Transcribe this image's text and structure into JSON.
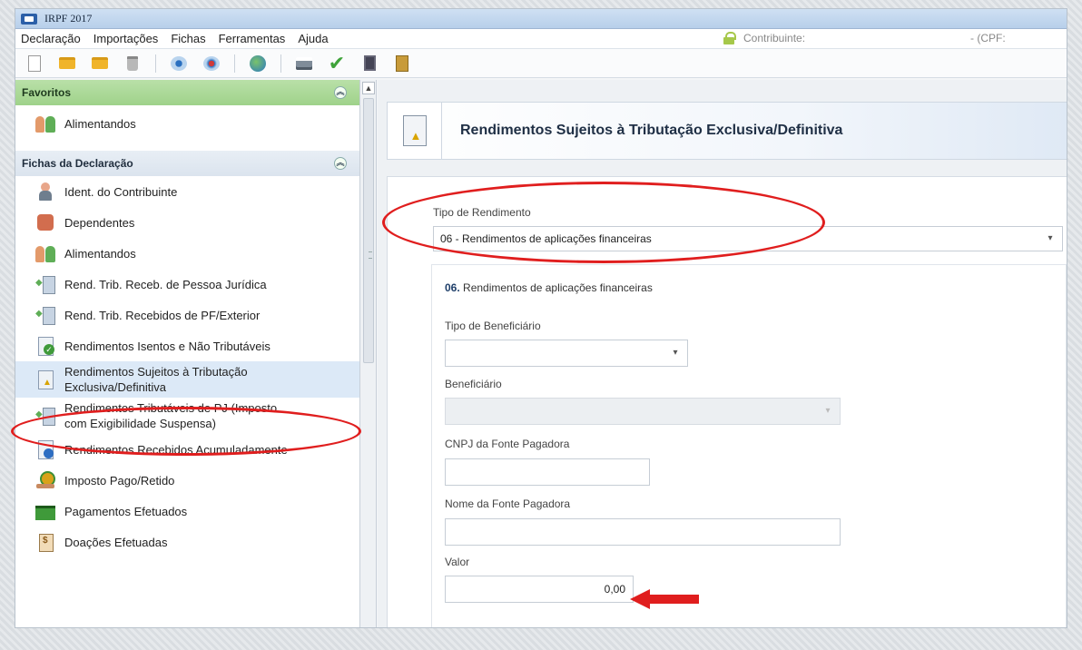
{
  "window": {
    "title": "IRPF 2017"
  },
  "menu": [
    "Declaração",
    "Importações",
    "Fichas",
    "Ferramentas",
    "Ajuda"
  ],
  "status": {
    "contribuinte_label": "Contribuinte:",
    "cpf_label": "- (CPF:"
  },
  "sidebar": {
    "favoritos_title": "Favoritos",
    "favoritos_items": [
      "Alimentandos"
    ],
    "fichas_title": "Fichas da Declaração",
    "items": [
      {
        "label": "Ident. do Contribuinte",
        "icon": "person-icon"
      },
      {
        "label": "Dependentes",
        "icon": "dependents-icon"
      },
      {
        "label": "Alimentandos",
        "icon": "people-icon"
      },
      {
        "label": "Rend. Trib. Receb. de Pessoa Jurídica",
        "icon": "income-company-icon"
      },
      {
        "label": "Rend. Trib. Recebidos de PF/Exterior",
        "icon": "income-person-icon"
      },
      {
        "label": "Rendimentos Isentos e Não Tributáveis",
        "icon": "exempt-income-icon"
      },
      {
        "label": "Rendimentos Sujeitos à Tributação Exclusiva/Definitiva",
        "icon": "exclusive-tax-icon",
        "selected": true
      },
      {
        "label": "Rendimentos Tributáveis de PJ (Imposto com Exigibilidade Suspensa)",
        "icon": "suspended-tax-icon"
      },
      {
        "label": "Rendimentos Recebidos Acumuladamente",
        "icon": "accumulated-income-icon"
      },
      {
        "label": "Imposto Pago/Retido",
        "icon": "tax-paid-icon"
      },
      {
        "label": "Pagamentos Efetuados",
        "icon": "payments-icon"
      },
      {
        "label": "Doações Efetuadas",
        "icon": "donations-icon"
      }
    ]
  },
  "main": {
    "title": "Rendimentos Sujeitos à Tributação Exclusiva/Definitiva",
    "tipo_label": "Tipo de Rendimento",
    "tipo_value": "06 - Rendimentos de aplicações financeiras",
    "section_number": "06.",
    "section_title": "Rendimentos de aplicações financeiras",
    "tipo_beneficiario_label": "Tipo de Beneficiário",
    "tipo_beneficiario_value": "",
    "beneficiario_label": "Beneficiário",
    "beneficiario_value": "",
    "cnpj_label": "CNPJ da Fonte Pagadora",
    "cnpj_value": "",
    "nome_label": "Nome da Fonte Pagadora",
    "nome_value": "",
    "valor_label": "Valor",
    "valor_value": "0,00"
  },
  "colors": {
    "annotation": "#e01e1e",
    "favoritos_header": "#9fd28a",
    "selected_row": "#dce9f7"
  }
}
